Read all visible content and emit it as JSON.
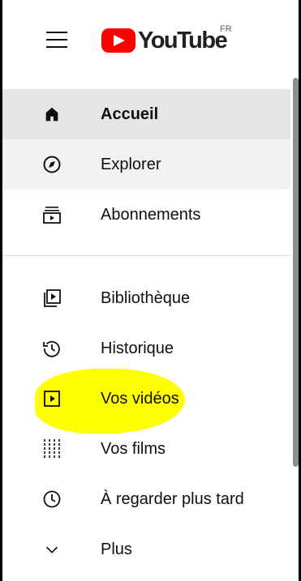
{
  "header": {
    "brand": "YouTube",
    "country_code": "FR"
  },
  "colors": {
    "brand_red": "#ff0000",
    "active_bg": "#e5e5e5",
    "hover_bg": "#f2f2f2",
    "highlight": "#ffff00"
  },
  "nav": {
    "main": [
      {
        "label": "Accueil",
        "icon": "home-icon",
        "state": "active"
      },
      {
        "label": "Explorer",
        "icon": "compass-icon",
        "state": "hover"
      },
      {
        "label": "Abonnements",
        "icon": "subscriptions-icon",
        "state": "normal"
      }
    ],
    "library": [
      {
        "label": "Bibliothèque",
        "icon": "library-icon"
      },
      {
        "label": "Historique",
        "icon": "history-icon"
      },
      {
        "label": "Vos vidéos",
        "icon": "your-videos-icon",
        "highlighted": true
      },
      {
        "label": "Vos films",
        "icon": "film-icon"
      },
      {
        "label": "À regarder plus tard",
        "icon": "watch-later-icon"
      },
      {
        "label": "Plus",
        "icon": "chevron-down-icon"
      }
    ]
  }
}
